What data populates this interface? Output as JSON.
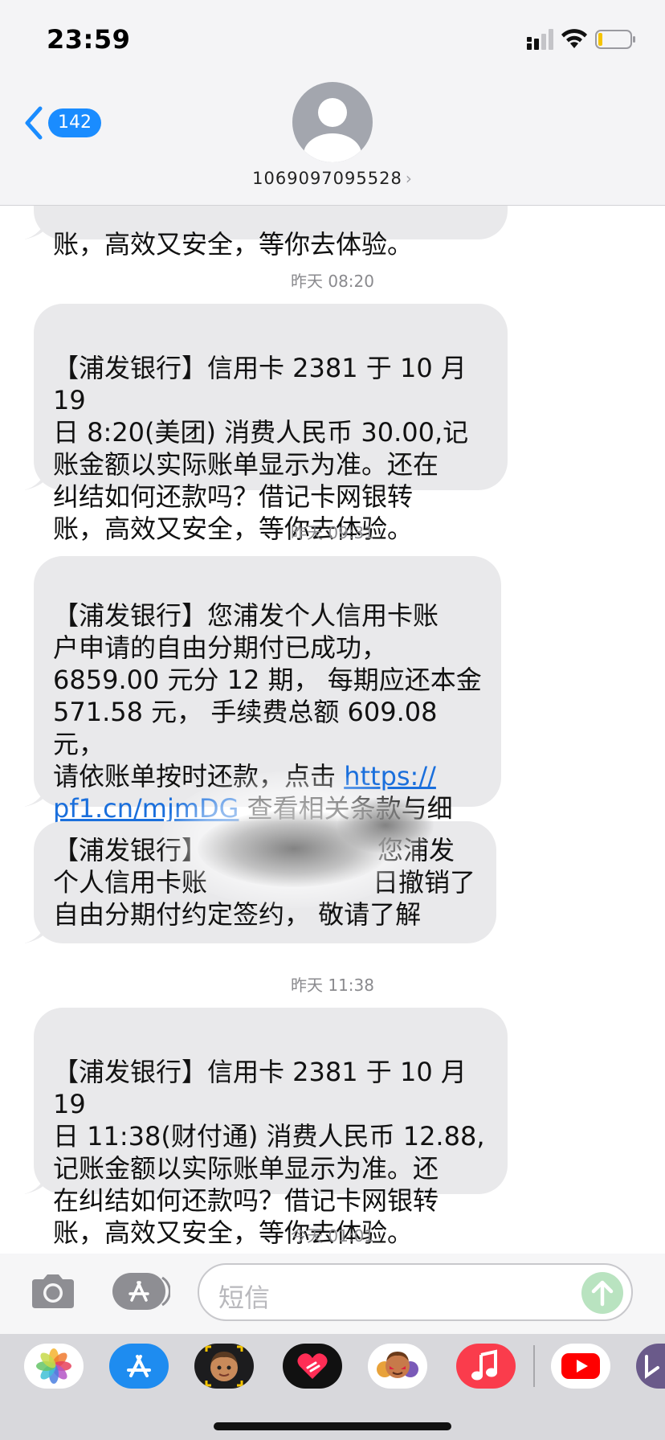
{
  "status_bar": {
    "time": "23:59"
  },
  "header": {
    "back_count": "142",
    "contact": "1069097095528",
    "contact_chevron": "›"
  },
  "messages": [
    {
      "timestamp": "",
      "text": "账，高效又安全，等你去体验。"
    },
    {
      "timestamp": "昨天 08:20",
      "text": "【浦发银行】信用卡 2381 于 10 月 19\n日 8:20(美团) 消费人民币 30.00,记\n账金额以实际账单显示为准。还在\n纠结如何还款吗？借记卡网银转\n账，高效又安全，等你去体验。"
    },
    {
      "timestamp": "昨天 09:31",
      "text_before_link": "【浦发银行】您浦发个人信用卡账\n户申请的自由分期付已成功，\n6859.00 元分 12 期， 每期应还本金\n571.58 元， 手续费总额 609.08 元，\n请依账单按时还款，点击 ",
      "link": "https://\npf1.cn/mjmDG",
      "text_after_link": "  查看相关条款与细\n则。"
    },
    {
      "timestamp": "",
      "line1_left": "【浦发银行】",
      "line1_right": "您浦发",
      "line2_left": "个人信用卡账",
      "line2_right": "日撤销了",
      "line3": "自由分期付约定签约， 敬请了解"
    },
    {
      "timestamp": "昨天 11:38",
      "text": "【浦发银行】信用卡 2381 于 10 月 19\n日 11:38(财付通) 消费人民币 12.88,\n记账金额以实际账单显示为准。还\n在纠结如何还款吗？借记卡网银转\n账，高效又安全，等你去体验。"
    },
    {
      "timestamp": "今天 01:01"
    }
  ],
  "composer": {
    "placeholder": "短信"
  },
  "app_drawer": [
    "photos-icon",
    "app-store-icon",
    "memoji-icon",
    "digital-touch-icon",
    "animoji-icon",
    "music-icon",
    "youtube-icon",
    "more-app-icon"
  ],
  "colors": {
    "bubble": "#e9e9eb",
    "link": "#1a6fdc",
    "badge": "#1a8cff",
    "send": "#b9e3c0"
  }
}
